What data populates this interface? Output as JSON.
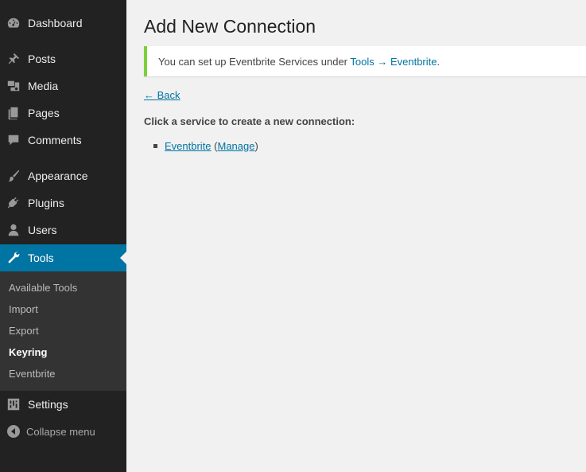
{
  "sidebar": {
    "items": [
      {
        "label": "Dashboard",
        "icon": "dashboard-icon"
      },
      {
        "label": "Posts",
        "icon": "pin-icon"
      },
      {
        "label": "Media",
        "icon": "media-icon"
      },
      {
        "label": "Pages",
        "icon": "pages-icon"
      },
      {
        "label": "Comments",
        "icon": "comment-icon"
      },
      {
        "label": "Appearance",
        "icon": "brush-icon"
      },
      {
        "label": "Plugins",
        "icon": "plugin-icon"
      },
      {
        "label": "Users",
        "icon": "user-icon"
      },
      {
        "label": "Tools",
        "icon": "wrench-icon"
      },
      {
        "label": "Settings",
        "icon": "settings-icon"
      }
    ],
    "submenu": [
      "Available Tools",
      "Import",
      "Export",
      "Keyring",
      "Eventbrite"
    ],
    "collapse_label": "Collapse menu"
  },
  "main": {
    "title": "Add New Connection",
    "notice": {
      "prefix": "You can set up Eventbrite Services under ",
      "link": "Tools → Eventbrite",
      "suffix": "."
    },
    "back_label": "← Back",
    "instruction": "Click a service to create a new connection:",
    "service": {
      "name": "Eventbrite",
      "manage": "Manage"
    }
  },
  "colors": {
    "accent": "#0074a2",
    "notice_border": "#7ad03a",
    "sidebar": "#222222",
    "submenu": "#333333"
  }
}
